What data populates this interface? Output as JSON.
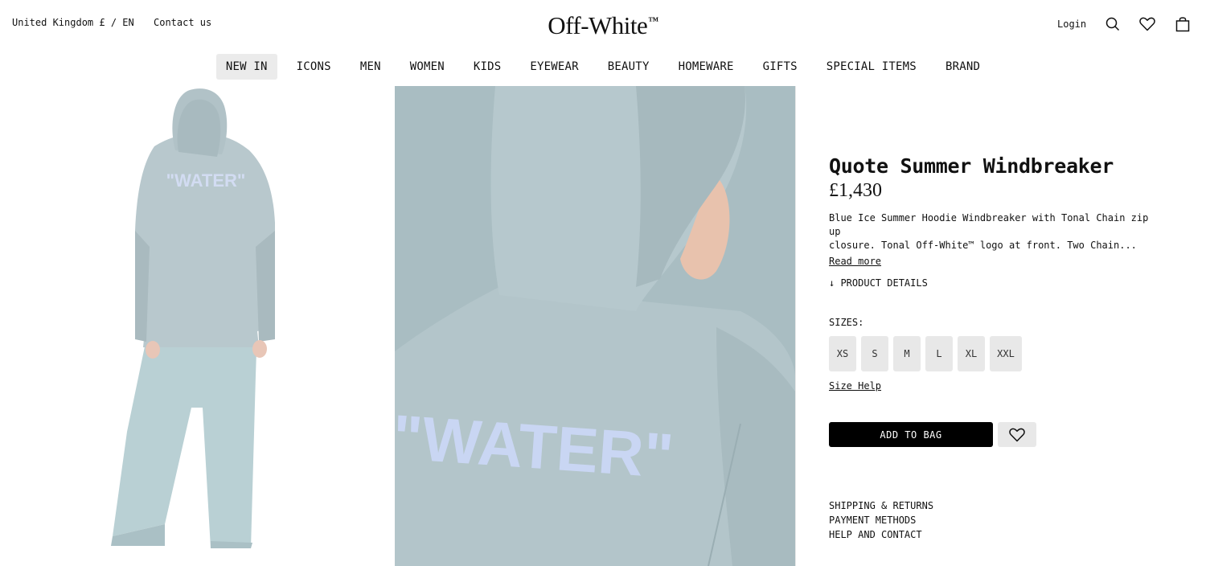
{
  "header": {
    "locale": "United Kingdom £ / EN",
    "contact": "Contact us",
    "logo": "Off-White",
    "logo_tm": "™",
    "login": "Login",
    "icons": [
      "search-icon",
      "heart-icon",
      "shopping-bag-icon"
    ]
  },
  "nav": {
    "items": [
      "NEW IN",
      "ICONS",
      "MEN",
      "WOMEN",
      "KIDS",
      "EYEWEAR",
      "BEAUTY",
      "HOMEWARE",
      "GIFTS",
      "SPECIAL ITEMS",
      "BRAND"
    ],
    "active": "NEW IN"
  },
  "gallery": {
    "print_text": "\"WATER\""
  },
  "product": {
    "title": "Quote Summer Windbreaker",
    "price": "£1,430",
    "description_1": "Blue Ice Summer Hoodie Windbreaker with Tonal Chain zip up",
    "description_2": "closure. Tonal Off-White™ logo at front. Two Chain...",
    "read_more": "Read more",
    "product_details": "↓ PRODUCT DETAILS",
    "sizes_label": "SIZES:",
    "sizes": [
      "XS",
      "S",
      "M",
      "L",
      "XL",
      "XXL"
    ],
    "size_help": "Size Help",
    "add_to_bag": "ADD TO BAG",
    "links": [
      "SHIPPING & RETURNS",
      "PAYMENT METHODS",
      "HELP AND CONTACT"
    ]
  },
  "colors": {
    "garment": "#b6c7cb",
    "print": "#c9d6f3",
    "button": "#000000",
    "chip": "#e8e8e8"
  }
}
